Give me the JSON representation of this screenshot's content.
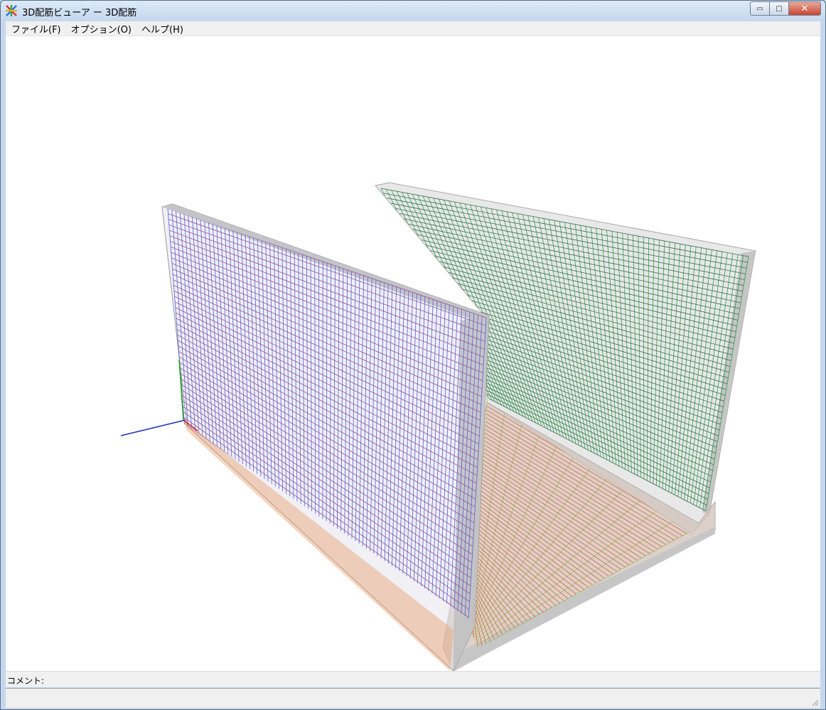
{
  "window": {
    "title": "3D配筋ビューア ー 3D配筋",
    "buttons": {
      "minimize": "▭",
      "maximize": "□",
      "close": "✕"
    }
  },
  "menu": [
    {
      "label": "ファイル(F)"
    },
    {
      "label": "オプション(O)"
    },
    {
      "label": "ヘルプ(H)"
    }
  ],
  "comment": {
    "label": "コメント:"
  },
  "colors": {
    "left_wall_rebar": "#5a66e0",
    "right_wall_rebar": "#2fa04a",
    "slab_rebar": "#d9663a",
    "concrete": "#c8c8c8",
    "axis_x": "#cc2222",
    "axis_y": "#22aa22",
    "axis_z": "#2233bb"
  }
}
